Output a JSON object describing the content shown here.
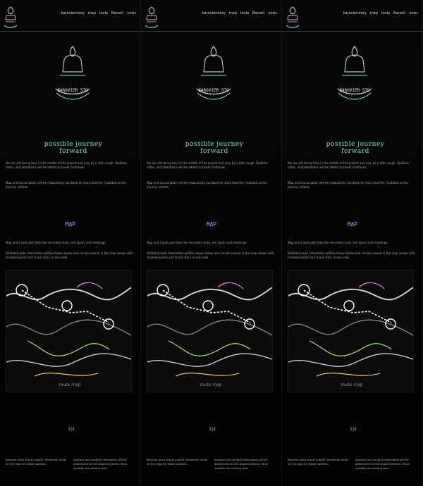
{
  "nav": {
    "items": [
      "barovierstory",
      "map",
      "tesla",
      "Barsell",
      "news"
    ]
  },
  "hero": {
    "logo_text": "BAROVIER STO",
    "headline": "possible journey forward"
  },
  "paragraphs": {
    "p1": "We are still being here in the middle of the project and may be a little rough. Updates, notes, and alterations will be added as travel continues.",
    "p2": "Map and transcription will be replaced by our Barovier story timeline. Updated as the journey unfolds."
  },
  "section": {
    "title": "MAP"
  },
  "paragraphs2": {
    "p3": "Map and travel path from the recorded route, see layers and markings.",
    "p4": "Detailed route information will be shown below and can be viewed in the map viewer with traveled points and travel story in one view."
  },
  "map": {
    "label": "route map"
  },
  "page_indicator": "1|2",
  "footer": {
    "left": "Barovier story travel project, follow the route on the map for latest updates.",
    "right": "Sponsor and contact information will be added here as the project evolves. More updates are coming soon."
  },
  "colors": {
    "accent": "#73e3c6",
    "section": "#b98cff"
  }
}
